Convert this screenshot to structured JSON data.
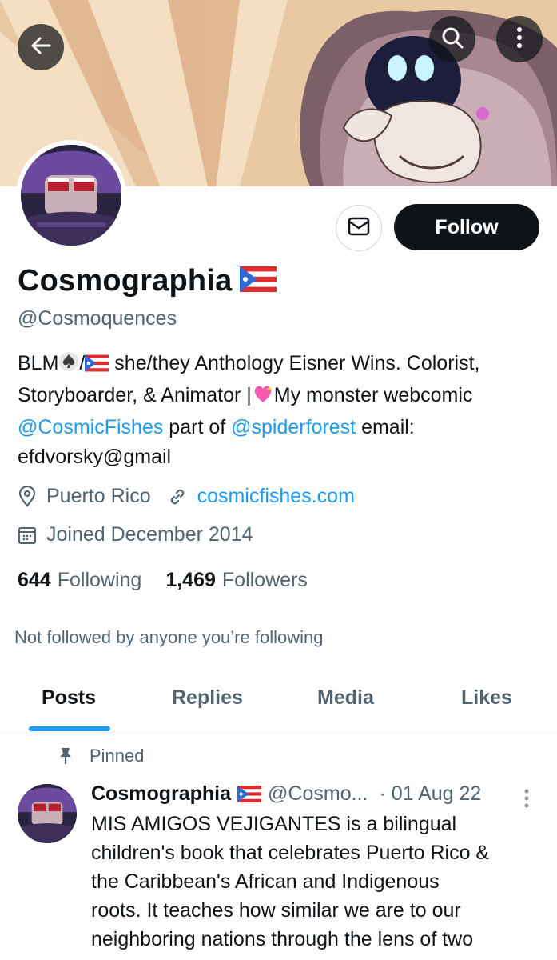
{
  "nav": {
    "back_icon": "arrow-left-icon",
    "search_icon": "search-icon",
    "more_icon": "more-vertical-icon"
  },
  "profile": {
    "name": "Cosmographia",
    "flag_icon": "puerto-rico-flag",
    "handle": "@Cosmoquences",
    "follow_label": "Follow",
    "message_icon": "envelope-icon",
    "bio": {
      "line1_a": "BLM",
      "line1_b": "/",
      "line1_c": " she/they Anthology Eisner Wins. Colorist,",
      "line2_a": "Storyboarder, & Animator |",
      "line2_b": "My monster webcomic",
      "mention1": "@CosmicFishes",
      "line3_mid": " part of ",
      "mention2": "@spiderforest",
      "line3_end": " email:",
      "line4": "efdvorsky@gmail"
    },
    "location": "Puerto Rico",
    "website": "cosmicfishes.com",
    "joined": "Joined December 2014",
    "following_count": "644",
    "following_label": "Following",
    "followers_count": "1,469",
    "followers_label": "Followers",
    "not_followed": "Not followed by anyone you’re following"
  },
  "tabs": [
    {
      "label": "Posts",
      "active": true
    },
    {
      "label": "Replies",
      "active": false
    },
    {
      "label": "Media",
      "active": false
    },
    {
      "label": "Likes",
      "active": false
    }
  ],
  "post": {
    "pinned_label": "Pinned",
    "author_name": "Cosmographia",
    "author_handle": "@Cosmo...",
    "date": "· 01 Aug 22",
    "text_lines": [
      "MIS AMIGOS VEJIGANTES is a bilingual",
      "children's book that celebrates Puerto Rico &",
      "the Caribbean's African and Indigenous",
      "roots. It teaches how similar we are to our",
      "neighboring nations through the lens of two"
    ]
  },
  "colors": {
    "accent": "#1d9bf0",
    "text": "#0f1419",
    "secondary": "#536471",
    "follow_bg": "#0f1419"
  }
}
